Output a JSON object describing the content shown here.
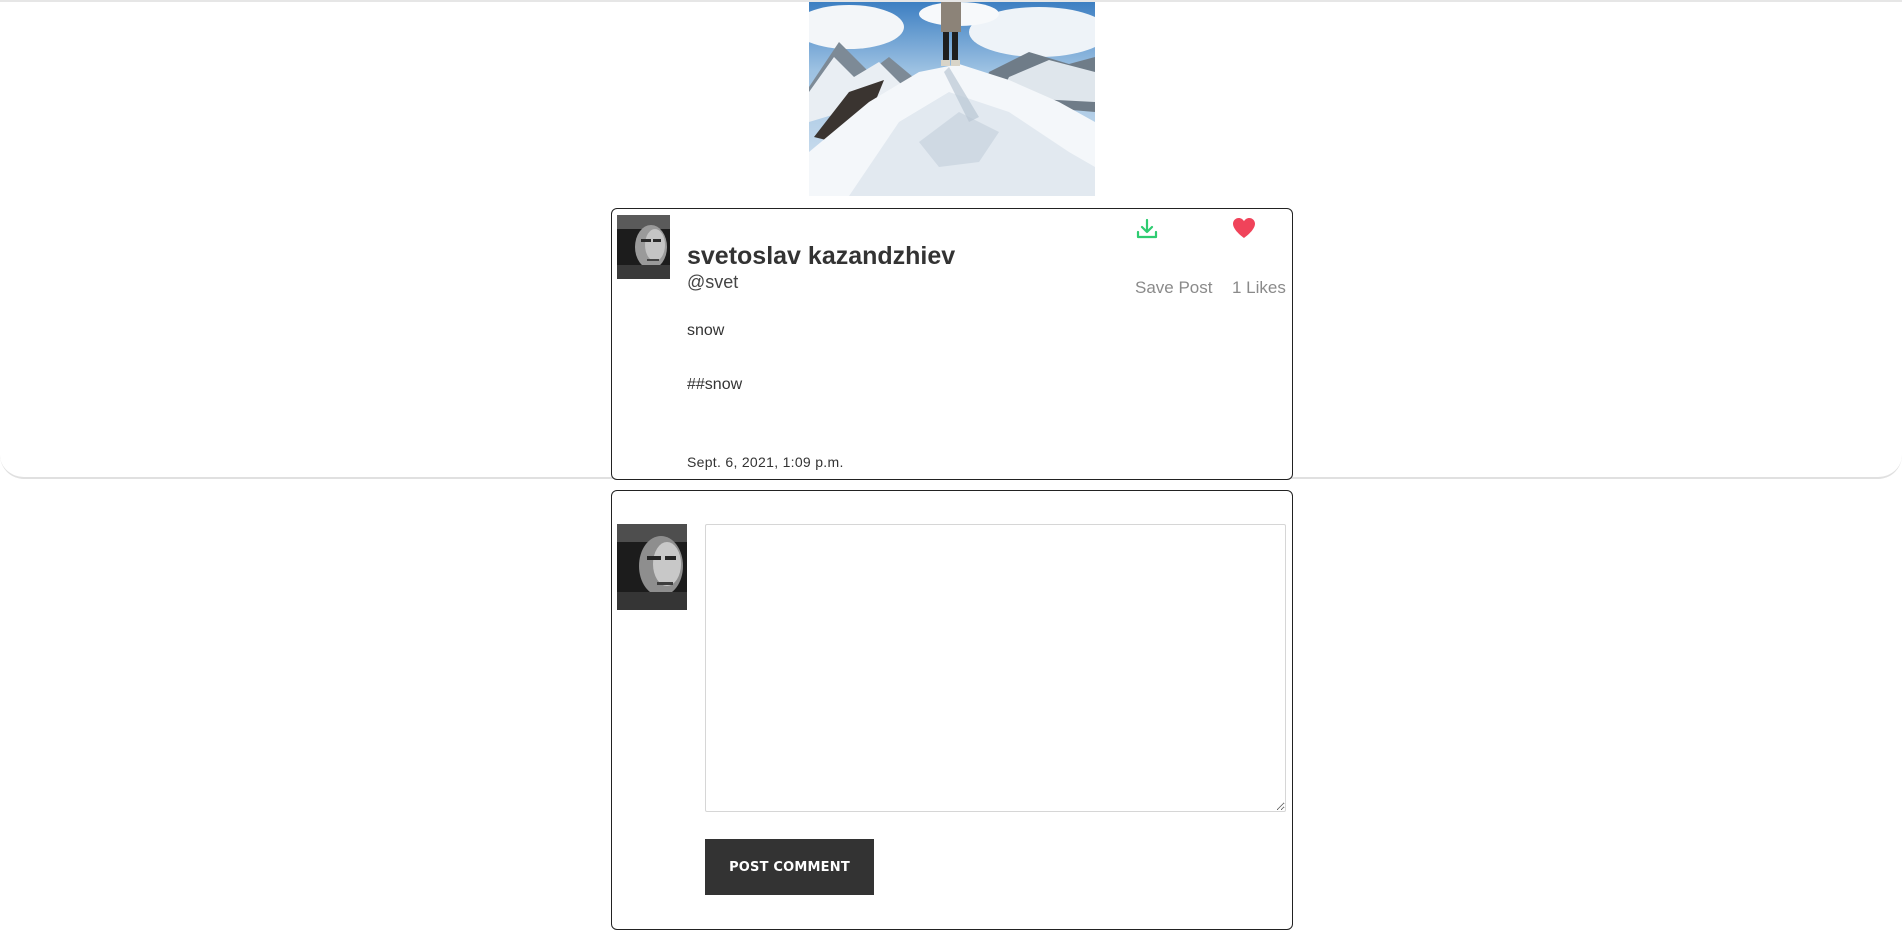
{
  "post": {
    "author_name": "svetoslav kazandzhiev",
    "author_handle": "@svet",
    "text": "snow",
    "tags": "##snow",
    "date": "Sept. 6, 2021, 1:09 p.m.",
    "save_label": "Save Post",
    "likes_label": "1 Likes",
    "icons": {
      "save": "download-icon",
      "like": "heart-icon"
    },
    "colors": {
      "save_icon": "#2ecc71",
      "like_icon": "#f0435a"
    }
  },
  "comment_form": {
    "textarea_value": "",
    "button_label": "POST COMMENT"
  }
}
